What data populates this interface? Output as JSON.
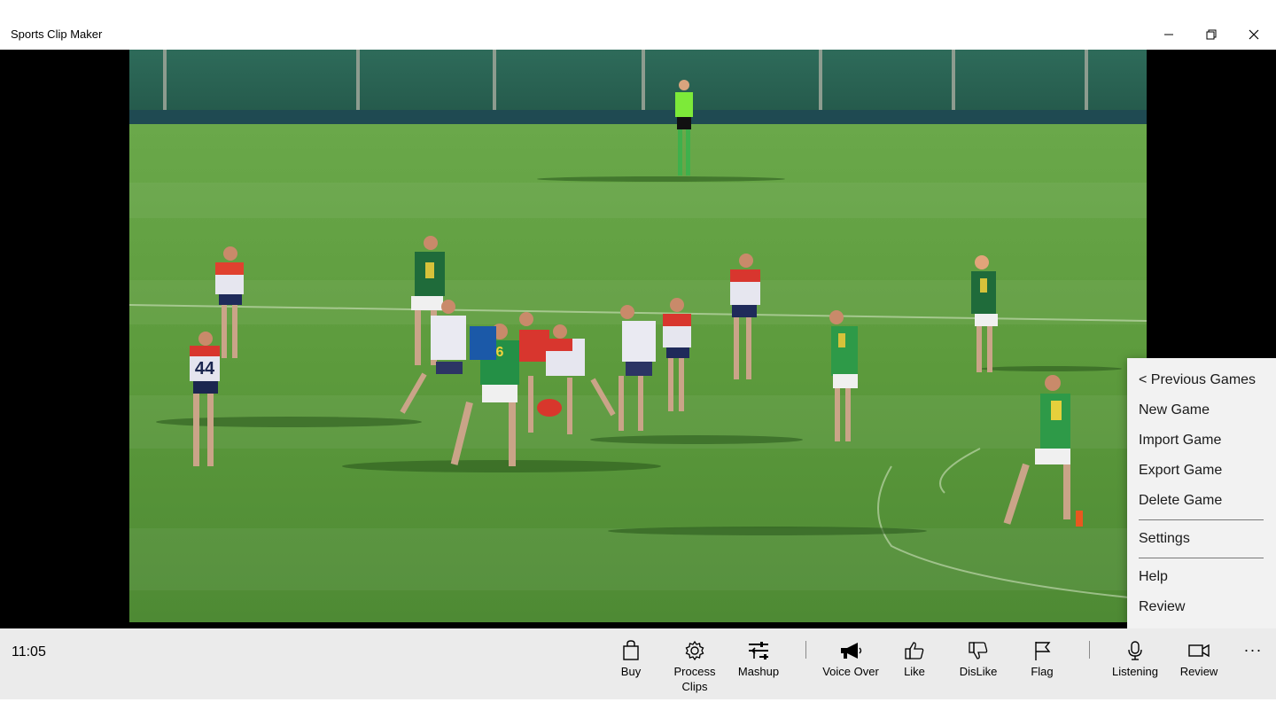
{
  "window": {
    "title": "Sports Clip Maker",
    "controls": {
      "minimize": "minimize-icon",
      "maximize": "restore-icon",
      "close": "close-icon"
    }
  },
  "video": {
    "player_jersey_numbers": [
      "44",
      "6"
    ]
  },
  "menu": {
    "items": [
      {
        "label": "< Previous Games"
      },
      {
        "label": "New Game"
      },
      {
        "label": "Import Game"
      },
      {
        "label": "Export Game"
      },
      {
        "label": "Delete Game"
      },
      {
        "label": "Settings"
      },
      {
        "label": "Help"
      },
      {
        "label": "Review"
      }
    ]
  },
  "command_bar": {
    "time": "11:05",
    "buttons": {
      "buy": {
        "label": "Buy",
        "icon": "shopping-bag-icon"
      },
      "process_clips": {
        "label": "Process Clips",
        "line1": "Process",
        "line2": "Clips",
        "icon": "gear-icon"
      },
      "mashup": {
        "label": "Mashup",
        "icon": "mashup-icon"
      },
      "voice_over": {
        "label": "Voice Over",
        "icon": "megaphone-icon"
      },
      "like": {
        "label": "Like",
        "icon": "thumbs-up-icon"
      },
      "dislike": {
        "label": "DisLike",
        "icon": "thumbs-down-icon"
      },
      "flag": {
        "label": "Flag",
        "icon": "flag-icon"
      },
      "listening": {
        "label": "Listening",
        "icon": "microphone-icon"
      },
      "review": {
        "label": "Review",
        "icon": "video-camera-icon"
      }
    },
    "more_label": "···"
  },
  "colors": {
    "titlebar_bg": "#ffffff",
    "letterbox": "#000000",
    "grass": "#5f9a3e",
    "command_bar_bg": "#ebebeb",
    "menu_bg": "#f2f2f2"
  }
}
